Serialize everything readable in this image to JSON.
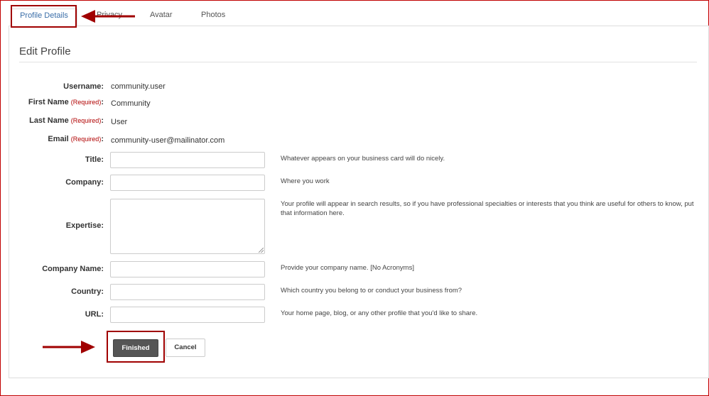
{
  "tabs": [
    "Profile Details",
    "Privacy",
    "Avatar",
    "Photos"
  ],
  "page_title": "Edit Profile",
  "required_marker": "(Required)",
  "info_fields": [
    {
      "label": "Username:",
      "value": "community.user"
    },
    {
      "label": "First Name",
      "value": "Community"
    },
    {
      "label": "Last Name",
      "value": "User"
    },
    {
      "label": "Email",
      "value": "community-user@mailinator.com"
    }
  ],
  "input_fields": [
    {
      "label": "Title:",
      "value": "",
      "help": "Whatever appears on your business card will do nicely."
    },
    {
      "label": "Company:",
      "value": "",
      "help": "Where you work"
    },
    {
      "label": "Expertise:",
      "value": "",
      "help": "Your profile will appear in search results, so if you have professional specialties or interests that you think are useful for others to know, put that information here."
    },
    {
      "label": "Company Name:",
      "value": "",
      "help": "Provide your company name. [No Acronyms]"
    },
    {
      "label": "Country:",
      "value": "",
      "help": "Which country you belong to or conduct your business from?"
    },
    {
      "label": "URL:",
      "value": "",
      "help": "Your home page, blog, or any other profile that you'd like to share."
    }
  ],
  "buttons": {
    "finished": "Finished",
    "cancel": "Cancel"
  },
  "colors": {
    "annotation": "#a00000",
    "active_tab": "#3a6ea8",
    "primary_button": "#555555"
  }
}
